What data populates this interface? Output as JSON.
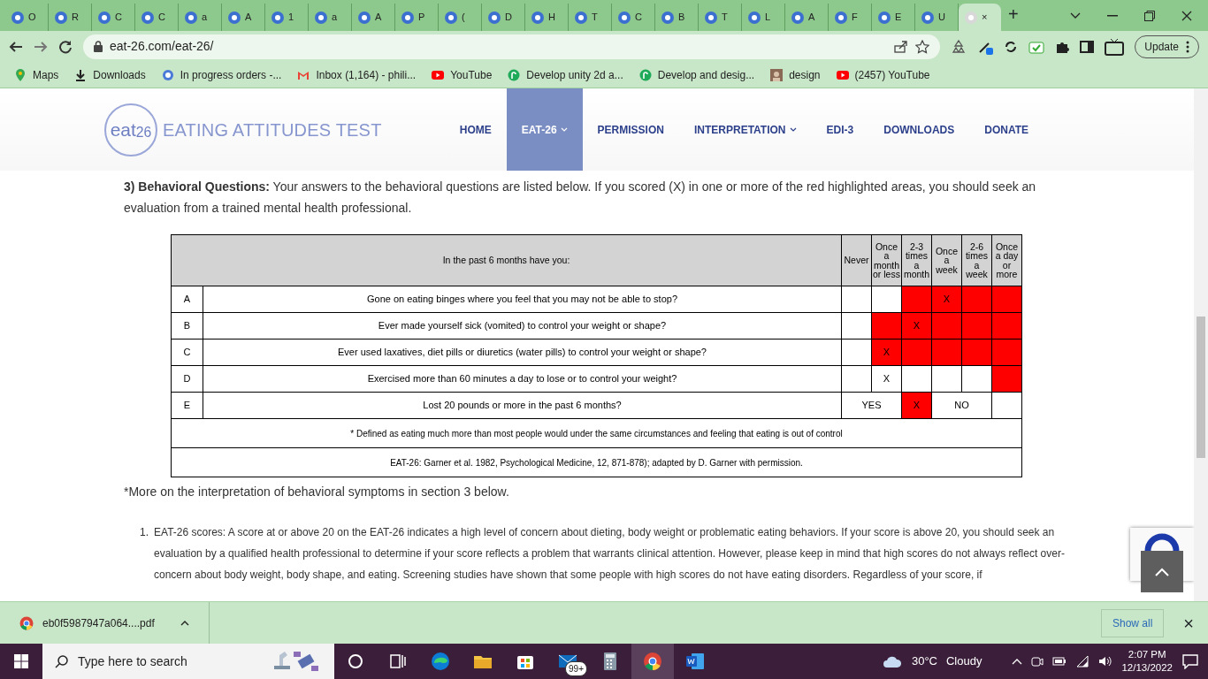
{
  "browser": {
    "tabs": [
      {
        "label": "O",
        "selected": false
      },
      {
        "label": "R",
        "selected": false
      },
      {
        "label": "C",
        "selected": false
      },
      {
        "label": "C",
        "selected": false
      },
      {
        "label": "a",
        "selected": false
      },
      {
        "label": "A",
        "selected": false
      },
      {
        "label": "1",
        "selected": false
      },
      {
        "label": "a",
        "selected": false
      },
      {
        "label": "A",
        "selected": false
      },
      {
        "label": "P",
        "selected": false
      },
      {
        "label": "(",
        "selected": false
      },
      {
        "label": "D",
        "selected": false
      },
      {
        "label": "H",
        "selected": false
      },
      {
        "label": "T",
        "selected": false
      },
      {
        "label": "C",
        "selected": false
      },
      {
        "label": "B",
        "selected": false
      },
      {
        "label": "T",
        "selected": false
      },
      {
        "label": "L",
        "selected": false
      },
      {
        "label": "A",
        "selected": false
      },
      {
        "label": "F",
        "selected": false
      },
      {
        "label": "E",
        "selected": false
      },
      {
        "label": "U",
        "selected": false
      },
      {
        "selected": true,
        "close": "×"
      }
    ],
    "new_tab": "+",
    "address": "eat-26.com/eat-26/",
    "update_button": "Update",
    "bookmarks": [
      {
        "label": "Maps"
      },
      {
        "label": "Downloads"
      },
      {
        "label": "In progress orders -..."
      },
      {
        "label": "Inbox (1,164) - phili..."
      },
      {
        "label": "YouTube"
      },
      {
        "label": "Develop unity 2d a..."
      },
      {
        "label": "Develop and desig..."
      },
      {
        "label": "design"
      },
      {
        "label": "(2457) YouTube"
      }
    ]
  },
  "site": {
    "logo": "eat$_{26}$",
    "title": "EATING ATTITUDES TEST",
    "nav": [
      {
        "label": "HOME",
        "selected": false,
        "dropdown": false
      },
      {
        "label": "EAT-26",
        "selected": true,
        "dropdown": true
      },
      {
        "label": "PERMISSION",
        "selected": false,
        "dropdown": false
      },
      {
        "label": "INTERPRETATION",
        "selected": false,
        "dropdown": true
      },
      {
        "label": "EDI-3",
        "selected": false,
        "dropdown": false
      },
      {
        "label": "DOWNLOADS",
        "selected": false,
        "dropdown": false
      },
      {
        "label": "DONATE",
        "selected": false,
        "dropdown": false
      }
    ]
  },
  "intro": "**3) Behavioral Questions:** Your answers to the behavioral questions are listed below. If you scored (X) in one or more of the red highlighted areas, you should seek an evaluation from a trained mental health professional.",
  "table": {
    "question_header": "In the past 6 months have you:",
    "columns": [
      "Never",
      "Once a month or less",
      "2-3 times a month",
      "Once a week",
      "2-6 times a week",
      "Once a day or more"
    ],
    "rows": [
      {
        "letter": "A",
        "question": "Gone on eating binges where you feel that you may not be able to stop?",
        "cells": [
          {
            "red": false
          },
          {
            "red": false
          },
          {
            "red": true
          },
          {
            "red": true,
            "text": "X"
          },
          {
            "red": true
          },
          {
            "red": true
          }
        ]
      },
      {
        "letter": "B",
        "question": "Ever made yourself sick (vomited) to control your weight or shape?",
        "cells": [
          {
            "red": false
          },
          {
            "red": true
          },
          {
            "red": true,
            "text": "X"
          },
          {
            "red": true
          },
          {
            "red": true
          },
          {
            "red": true
          }
        ]
      },
      {
        "letter": "C",
        "question": "Ever used laxatives, diet pills or diuretics (water pills) to control your weight or shape?",
        "cells": [
          {
            "red": false
          },
          {
            "red": true,
            "text": "X"
          },
          {
            "red": true
          },
          {
            "red": true
          },
          {
            "red": true
          },
          {
            "red": true
          }
        ]
      },
      {
        "letter": "D",
        "question": "Exercised more than 60 minutes a day to lose or to control your weight?",
        "cells": [
          {
            "red": false
          },
          {
            "red": false,
            "text": "X"
          },
          {
            "red": false
          },
          {
            "red": false
          },
          {
            "red": false
          },
          {
            "red": true
          }
        ]
      },
      {
        "letter": "E",
        "question": "Lost 20 pounds or more in the past 6 months?",
        "cells": [
          {
            "red": false,
            "text": "YES",
            "colspan": 2
          },
          {
            "red": true,
            "text": "X"
          },
          {
            "red": false,
            "text": "NO",
            "colspan": 2
          },
          {
            "red": false
          }
        ]
      }
    ],
    "footnotes": [
      "* Defined as eating much more than most people would under the same circumstances and feeling that eating is out of control",
      "EAT-26: Garner et al. 1982, Psychological Medicine, 12, 871-878); adapted by D. Garner with permission."
    ]
  },
  "note": "*More on the interpretation of behavioral symptoms in section 3 below.",
  "list": [
    {
      "number": "1.",
      "text": "EAT-26 scores: A score at or above 20 on the EAT-26 indicates a high level of concern about dieting, body weight or problematic eating behaviors. If your score is above 20, you should seek an evaluation by a qualified health professional to determine if your score reflects a problem that warrants clinical attention. However, please keep in mind that high scores do not always reflect over-concern about body weight, body shape, and eating. Screening studies have shown that some people with high scores do not have eating disorders. Regardless of your score, if"
    }
  ],
  "download": {
    "file": "eb0f5987947a064....pdf",
    "show_all": "Show all",
    "close": "×"
  },
  "taskbar": {
    "search_placeholder": "Type here to search",
    "badge": "99+",
    "temperature": "30°C",
    "condition": "Cloudy",
    "time": "2:07 PM",
    "date": "12/13/2022"
  }
}
